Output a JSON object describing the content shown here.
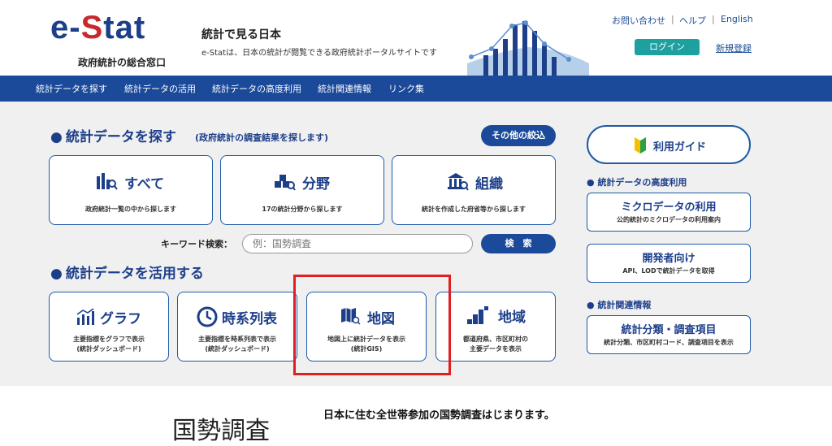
{
  "header": {
    "logo_e": "e-",
    "logo_s": "S",
    "logo_tat": "tat",
    "logo_sub": "政府統計の総合窓口",
    "site_title": "統計で見る日本",
    "site_desc": "e-Statは、日本の統計が閲覧できる政府統計ポータルサイトです",
    "contact": "お問い合わせ",
    "help": "ヘルプ",
    "english": "English",
    "login": "ログイン",
    "register": "新規登録"
  },
  "nav": [
    "統計データを探す",
    "統計データの活用",
    "統計データの高度利用",
    "統計関連情報",
    "リンク集"
  ],
  "search_section": {
    "heading": "統計データを探す",
    "note": "(政府統計の調査結果を探します)",
    "more_button": "その他の絞込",
    "cards": [
      {
        "title": "すべて",
        "desc": "政府統計一覧の中から探します"
      },
      {
        "title": "分野",
        "desc": "17の統計分野から探します"
      },
      {
        "title": "組織",
        "desc": "統計を作成した府省等から探します"
      }
    ],
    "keyword_label": "キーワード検索：",
    "keyword_placeholder": "例：国勢調査",
    "search_button": "検　索"
  },
  "use_section": {
    "heading": "統計データを活用する",
    "cards": [
      {
        "title": "グラフ",
        "desc1": "主要指標をグラフで表示",
        "desc2": "(統計ダッシュボード)"
      },
      {
        "title": "時系列表",
        "desc1": "主要指標を時系列表で表示",
        "desc2": "(統計ダッシュボード)"
      },
      {
        "title": "地図",
        "desc1": "地図上に統計データを表示",
        "desc2": "(統計GIS)"
      },
      {
        "title": "地域",
        "desc1": "都道府県、市区町村の",
        "desc2": "主要データを表示"
      }
    ]
  },
  "sidebar": {
    "guide": "利用ガイド",
    "advanced_heading": "統計データの高度利用",
    "micro_title": "ミクロデータの利用",
    "micro_desc": "公的統計のミクロデータの利用案内",
    "dev_title": "開発者向け",
    "dev_desc": "API、LODで統計データを取得",
    "related_heading": "統計関連情報",
    "class_title": "統計分類・調査項目",
    "class_desc": "統計分類、市区町村コード、調査項目を表示"
  },
  "bottom": {
    "census_logo": "国勢調査",
    "census_text": "日本に住む全世帯参加の国勢調査はじまります。"
  },
  "colors": {
    "navy": "#1b4a9b",
    "accent_red": "#c9282d",
    "login_teal": "#1ea0a0",
    "highlight": "#e02020"
  }
}
